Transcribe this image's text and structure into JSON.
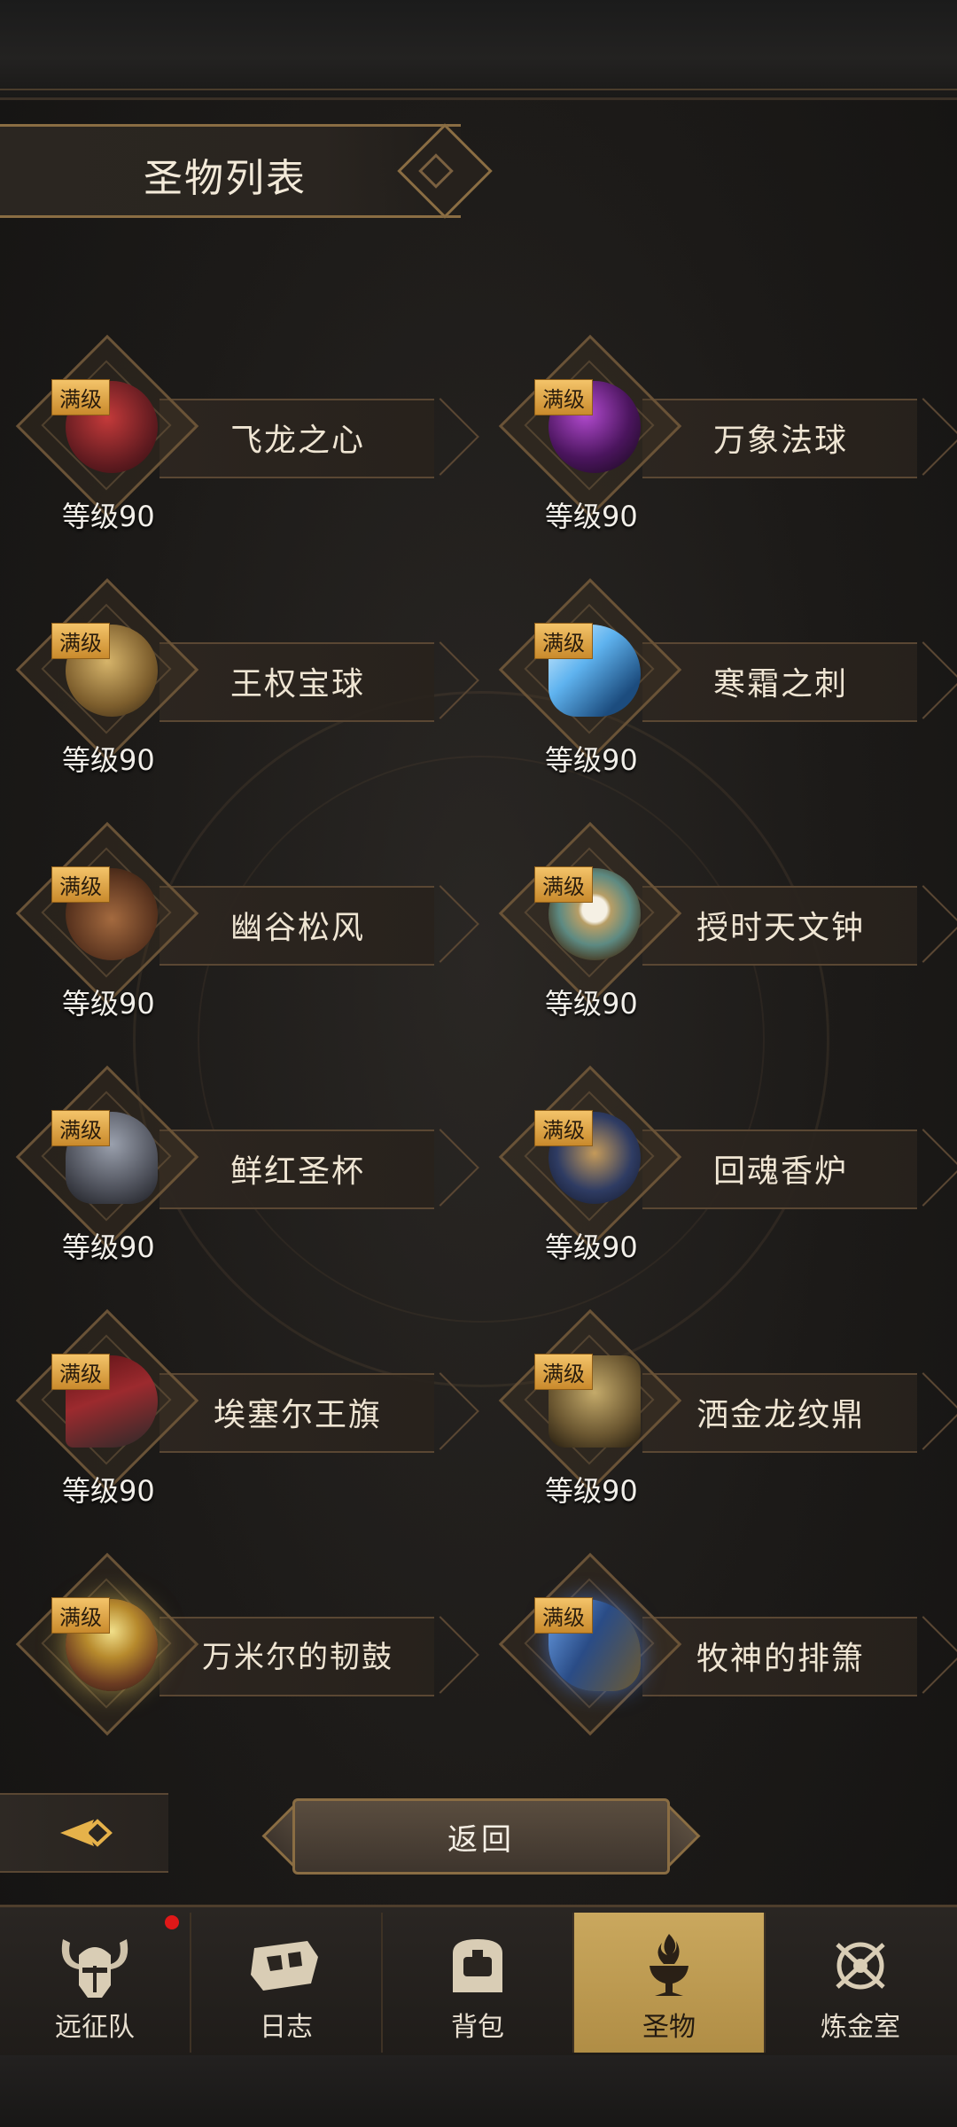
{
  "header": {
    "title": "圣物列表"
  },
  "relics": [
    {
      "name": "飞龙之心",
      "badge": "满级",
      "level": "等级90",
      "icon": "dragon-heart-icon",
      "color": "#7a1f24"
    },
    {
      "name": "万象法球",
      "badge": "满级",
      "level": "等级90",
      "icon": "arcane-orb-icon",
      "color": "#5b1b66"
    },
    {
      "name": "王权宝球",
      "badge": "满级",
      "level": "等级90",
      "icon": "royal-orb-icon",
      "color": "#8b6a35"
    },
    {
      "name": "寒霜之刺",
      "badge": "满级",
      "level": "等级90",
      "icon": "frost-spike-icon",
      "color": "#2b6ea7"
    },
    {
      "name": "幽谷松风",
      "badge": "满级",
      "level": "等级90",
      "icon": "lute-icon",
      "color": "#6a4027"
    },
    {
      "name": "授时天文钟",
      "badge": "满级",
      "level": "等级90",
      "icon": "astrolabe-clock-icon",
      "color": "#8d7b4e"
    },
    {
      "name": "鲜红圣杯",
      "badge": "满级",
      "level": "等级90",
      "icon": "chalice-icon",
      "color": "#5a5d66"
    },
    {
      "name": "回魂香炉",
      "badge": "满级",
      "level": "等级90",
      "icon": "censer-icon",
      "color": "#2c3c66"
    },
    {
      "name": "埃塞尔王旗",
      "badge": "满级",
      "level": "等级90",
      "icon": "banner-icon",
      "color": "#7b1c20"
    },
    {
      "name": "洒金龙纹鼎",
      "badge": "满级",
      "level": "等级90",
      "icon": "bronze-cauldron-icon",
      "color": "#6e5a32"
    },
    {
      "name": "万米尔的韧鼓",
      "badge": "满级",
      "level": "",
      "icon": "drum-icon",
      "color": "#7d5b2b"
    },
    {
      "name": "牧神的排箫",
      "badge": "满级",
      "level": "",
      "icon": "panpipes-icon",
      "color": "#2d4c86"
    }
  ],
  "actions": {
    "return_label": "返回"
  },
  "nav": {
    "items": [
      {
        "label": "远征队",
        "icon": "horned-helmet-icon",
        "active": false,
        "has_dot": true
      },
      {
        "label": "日志",
        "icon": "scroll-map-icon",
        "active": false,
        "has_dot": false
      },
      {
        "label": "背包",
        "icon": "backpack-icon",
        "active": false,
        "has_dot": false
      },
      {
        "label": "圣物",
        "icon": "flame-chalice-icon",
        "active": true,
        "has_dot": false
      },
      {
        "label": "炼金室",
        "icon": "alchemy-icon",
        "active": false,
        "has_dot": false
      }
    ]
  }
}
